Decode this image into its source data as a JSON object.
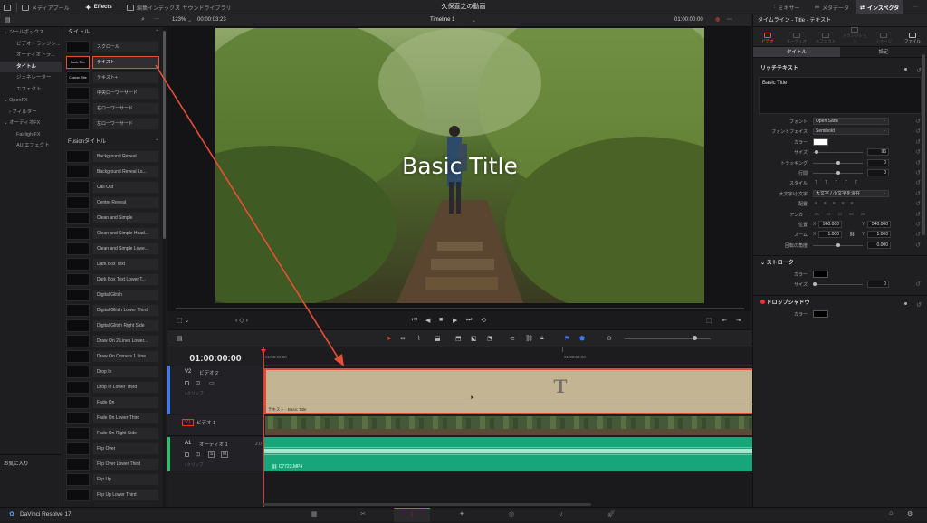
{
  "topbar": {
    "media_pool": "メディアプール",
    "effects": "Effects",
    "edit_index": "編集インデックス",
    "sound_library": "サウンドライブラリ",
    "project_title": "久保直之の動画",
    "mixer": "ミキサー",
    "metadata": "メタデータ",
    "inspector": "インスペクタ"
  },
  "tree": {
    "items": [
      {
        "label": "ツールボックス"
      },
      {
        "label": "ビデオトランジシ..."
      },
      {
        "label": "オーディオトラ..."
      },
      {
        "label": "タイトル"
      },
      {
        "label": "ジェネレーター"
      },
      {
        "label": "エフェクト"
      },
      {
        "label": "OpenFX"
      },
      {
        "label": "フィルター"
      },
      {
        "label": "オーディオFX"
      },
      {
        "label": "FairlightFX"
      },
      {
        "label": "AU エフェクト"
      }
    ],
    "favorites": "お気に入り"
  },
  "fx": {
    "titles_header": "タイトル",
    "titles": [
      {
        "thumb": "",
        "label": "スクロール"
      },
      {
        "thumb": "Basic Title",
        "label": "テキスト"
      },
      {
        "thumb": "Custom Title",
        "label": "テキスト+"
      },
      {
        "thumb": "",
        "label": "中央ローワーサード"
      },
      {
        "thumb": "",
        "label": "右ローワーサード"
      },
      {
        "thumb": "",
        "label": "左ローワーサード"
      }
    ],
    "fusion_header": "Fusionタイトル",
    "fusion": [
      {
        "thumb": "",
        "label": "Background Reveal"
      },
      {
        "thumb": "",
        "label": "Background Reveal Lo..."
      },
      {
        "thumb": "",
        "label": "Call Out"
      },
      {
        "thumb": "",
        "label": "Center Reveal"
      },
      {
        "thumb": "",
        "label": "Clean and Simple"
      },
      {
        "thumb": "",
        "label": "Clean and Simple Head..."
      },
      {
        "thumb": "",
        "label": "Clean and Simple Lowe..."
      },
      {
        "thumb": "",
        "label": "Dark Box Text"
      },
      {
        "thumb": "",
        "label": "Dark Box Text Lower T..."
      },
      {
        "thumb": "",
        "label": "Digital Glitch"
      },
      {
        "thumb": "",
        "label": "Digital Glitch Lower Third"
      },
      {
        "thumb": "",
        "label": "Digital Glitch Right Side"
      },
      {
        "thumb": "",
        "label": "Draw On 2 Lines Lower..."
      },
      {
        "thumb": "",
        "label": "Draw On Corners 1 Line"
      },
      {
        "thumb": "",
        "label": "Drop In"
      },
      {
        "thumb": "",
        "label": "Drop In Lower Third"
      },
      {
        "thumb": "",
        "label": "Fade On"
      },
      {
        "thumb": "",
        "label": "Fade On Lower Third"
      },
      {
        "thumb": "",
        "label": "Fade On Right Side"
      },
      {
        "thumb": "",
        "label": "Flip Over"
      },
      {
        "thumb": "",
        "label": "Flip Over Lower Third"
      },
      {
        "thumb": "",
        "label": "Flip Up"
      },
      {
        "thumb": "",
        "label": "Flip Up Lower Third"
      }
    ]
  },
  "viewer": {
    "zoom": "123%",
    "duration": "00:00:03:23",
    "timeline_name": "Timeline 1",
    "timecode": "01:00:00:00",
    "overlay_text": "Basic Title"
  },
  "timeline": {
    "timecode": "01:00:00:00",
    "ruler": [
      "01:00:00:00",
      "01:00:02:00",
      "01:00:04:00"
    ],
    "tracks": [
      {
        "id": "V2",
        "name": "ビデオ 2",
        "count": "1クリップ"
      },
      {
        "id": "V1",
        "name": "ビデオ 1",
        "count": ""
      },
      {
        "id": "A1",
        "name": "オーディオ 1",
        "level": "2.0",
        "count": "1クリップ"
      }
    ],
    "title_clip": {
      "label": "テキスト - Basic Title",
      "glyph": "T"
    },
    "audio_clip": {
      "label": "C7723.MP4"
    }
  },
  "inspector": {
    "header": "タイムライン - Title - テキスト",
    "tabs": [
      "ビデオ",
      "オーディオ",
      "エフェクト",
      "トランジション",
      "イメージ",
      "ファイル"
    ],
    "subtabs": [
      "タイトル",
      "設定"
    ],
    "rich_text": {
      "title": "リッチテキスト",
      "text": "Basic Title",
      "font_label": "フォント",
      "font": "Open Sans",
      "face_label": "フォントフェイス",
      "face": "Semibold",
      "color_label": "カラー",
      "size_label": "サイズ",
      "size": "96",
      "tracking_label": "トラッキング",
      "tracking": "0",
      "leading_label": "行間",
      "leading": "0",
      "style_label": "スタイル",
      "case_label": "大文字/小文字",
      "case": "大文字 / 小文字を混在",
      "align_label": "配置",
      "anchor_label": "アンカー",
      "pos_label": "位置",
      "pos_x": "960.000",
      "pos_y": "540.000",
      "zoom_label": "ズーム",
      "zoom_x": "1.000",
      "zoom_y": "1.000",
      "rot_label": "回転の角度",
      "rot": "0.000"
    },
    "stroke": {
      "title": "ストローク",
      "color_label": "カラー",
      "size_label": "サイズ",
      "size": "0"
    },
    "shadow": {
      "title": "ドロップシャドウ",
      "color_label": "カラー"
    }
  },
  "bottom": {
    "app": "DaVinci Resolve 17"
  },
  "colors": {
    "accent": "#e64f35",
    "title_clip": "#c3b493",
    "audio_clip": "#16a67a"
  }
}
